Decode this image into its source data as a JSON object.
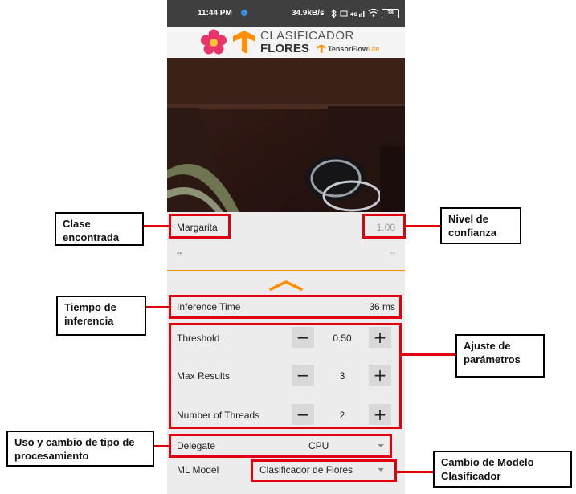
{
  "status_bar": {
    "time": "11:44 PM",
    "net_speed": "34.9kB/s",
    "battery": "38"
  },
  "app_header": {
    "title_line1": "CLASIFICADOR",
    "title_line2": "FLORES",
    "brand": "TensorFlow",
    "brand_suffix": "Lite"
  },
  "results": [
    {
      "label": "Margarita",
      "score": "1.00"
    },
    {
      "label": "--",
      "score": "--"
    },
    {
      "label": "--",
      "score": "--"
    }
  ],
  "inference": {
    "label": "Inference Time",
    "value": "36 ms"
  },
  "params": [
    {
      "label": "Threshold",
      "value": "0.50"
    },
    {
      "label": "Max Results",
      "value": "3"
    },
    {
      "label": "Number of Threads",
      "value": "2"
    }
  ],
  "delegate": {
    "label": "Delegate",
    "value": "CPU"
  },
  "ml_model": {
    "label": "ML Model",
    "value": "Clasificador de Flores"
  },
  "annotations": {
    "clase_encontrada": "Clase encontrada",
    "nivel_confianza": "Nivel de confianza",
    "tiempo_inferencia": "Tiempo de inferencia",
    "ajuste_parametros": "Ajuste de parámetros",
    "uso_cambio": "Uso y cambio de tipo de procesamiento",
    "cambio_modelo": "Cambio de Modelo Clasificador"
  },
  "colors": {
    "accent_orange": "#ff8f00",
    "annotation_red": "#e0000d",
    "flower_pink": "#e8336b"
  },
  "icons": [
    "flower-logo-icon",
    "tensorflow-logo-icon",
    "expand-chevron-icon",
    "minus-icon",
    "plus-icon",
    "dropdown-arrow-icon",
    "wifi-icon",
    "signal-icon",
    "battery-icon",
    "bluetooth-icon"
  ]
}
